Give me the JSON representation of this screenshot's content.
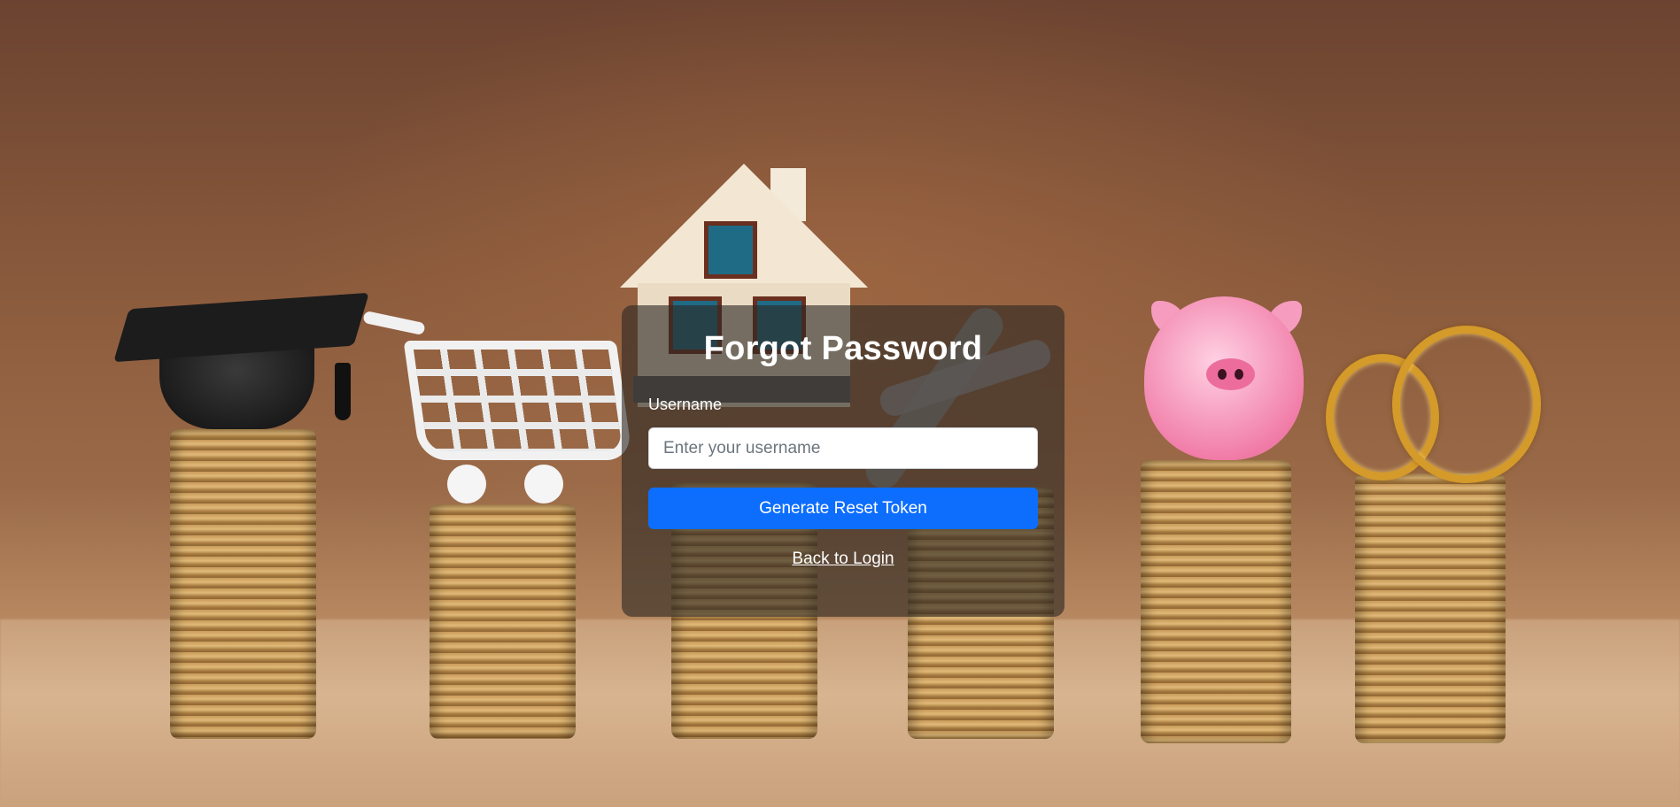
{
  "background": {
    "scene": "coin-stacks-with-financial-goal-icons",
    "icons": [
      "graduation-cap-icon",
      "shopping-cart-icon",
      "house-icon",
      "airplane-icon",
      "piggy-bank-icon",
      "wedding-rings-icon"
    ]
  },
  "card": {
    "title": "Forgot Password",
    "username_label": "Username",
    "username_placeholder": "Enter your username",
    "username_value": "",
    "submit_label": "Generate Reset Token",
    "back_link_label": "Back to Login"
  },
  "colors": {
    "primary_button": "#0d6efd",
    "card_overlay": "rgba(45,40,36,0.62)",
    "text": "#ffffff"
  }
}
